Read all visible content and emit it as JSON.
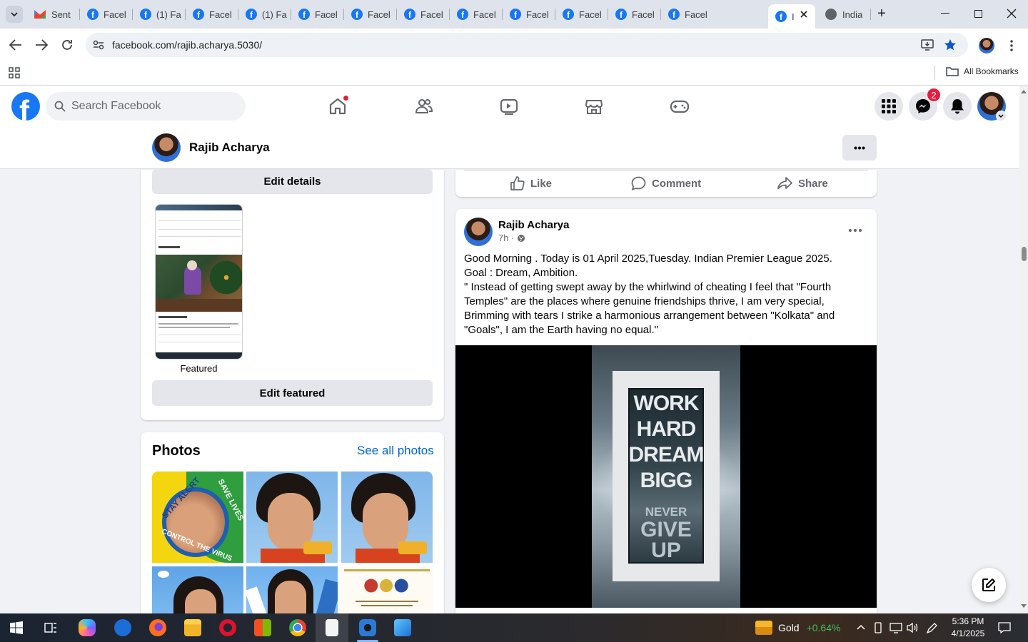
{
  "browser": {
    "tabs": [
      {
        "label": "Sent",
        "icon": "gmail-icon"
      },
      {
        "label": "Facel",
        "icon": "facebook-icon"
      },
      {
        "label": "(1) Fa",
        "icon": "facebook-icon"
      },
      {
        "label": "Facel",
        "icon": "facebook-icon"
      },
      {
        "label": "(1) Fa",
        "icon": "facebook-icon"
      },
      {
        "label": "Facel",
        "icon": "facebook-icon"
      },
      {
        "label": "Facel",
        "icon": "facebook-icon"
      },
      {
        "label": "Facel",
        "icon": "facebook-icon"
      },
      {
        "label": "Facel",
        "icon": "facebook-icon"
      },
      {
        "label": "Facel",
        "icon": "facebook-icon"
      },
      {
        "label": "Facel",
        "icon": "facebook-icon"
      },
      {
        "label": "Facel",
        "icon": "facebook-icon"
      },
      {
        "label": "Facel",
        "icon": "facebook-icon"
      },
      {
        "label": "I",
        "icon": "facebook-icon",
        "active": true
      },
      {
        "label": "India",
        "icon": "globe-icon"
      }
    ],
    "url": "facebook.com/rajib.acharya.5030/",
    "all_bookmarks": "All Bookmarks"
  },
  "fb_header": {
    "search_placeholder": "Search Facebook",
    "messenger_badge": "2"
  },
  "profile_bar": {
    "name": "Rajib Acharya"
  },
  "left_column": {
    "edit_details": "Edit details",
    "featured_caption": "Featured",
    "edit_featured": "Edit featured",
    "photos_title": "Photos",
    "see_all_photos": "See all photos",
    "photo_text": {
      "stay_alert": "STAY ALERT",
      "save_lives": "SAVE LIVES",
      "control_virus": "CONTROL THE VIRUS"
    }
  },
  "prev_post_actions": {
    "like": "Like",
    "comment": "Comment",
    "share": "Share"
  },
  "post": {
    "author": "Rajib Acharya",
    "time": "7h ·",
    "lines": [
      "Good Morning . Today is 01 April 2025,Tuesday. Indian Premier League 2025.",
      "Goal : Dream, Ambition.",
      "\" Instead of getting swept away by the whirlwind of cheating I feel that \"Fourth",
      "Temples\" are the places where genuine friendships thrive, I am very special,",
      "Brimming with tears I strike a harmonious arrangement between \"Kolkata\" and",
      "\"Goals\", I am the Earth having no equal.\""
    ],
    "image_text": [
      "WORK",
      "HARD",
      "DREAM",
      "BIGG",
      "NEVER",
      "GIVE",
      "UP"
    ]
  },
  "taskbar": {
    "gold_label": "Gold",
    "gold_change": "+0.64%",
    "time": "5:36 PM",
    "date": "4/1/2025"
  },
  "colors": {
    "facebook_blue": "#1877f2",
    "gold_green": "#3fbf5f"
  }
}
